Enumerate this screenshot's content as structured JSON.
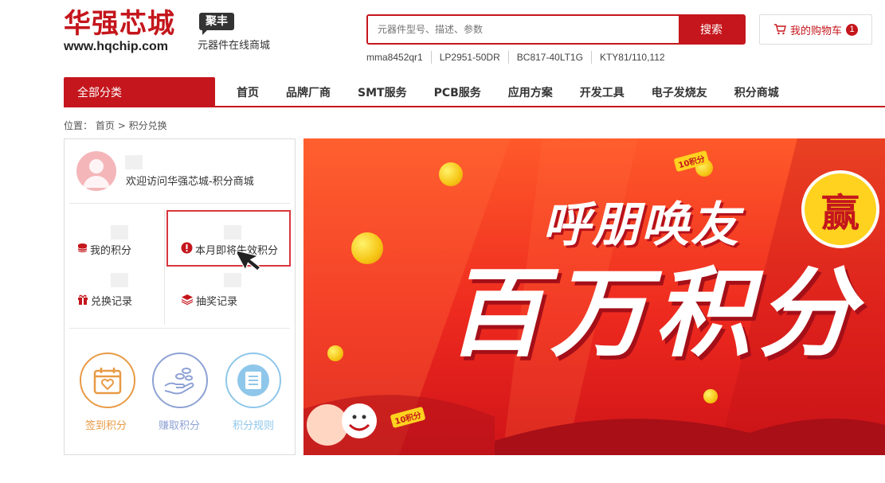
{
  "brand": {
    "name_cn": "华强芯城",
    "url": "www.hqchip.com",
    "badge": "聚丰",
    "slogan": "元器件在线商城"
  },
  "search": {
    "placeholder": "元器件型号、描述、参数",
    "button_label": "搜索"
  },
  "hot_words": [
    "mma8452qr1",
    "LP2951-50DR",
    "BC817-40LT1G",
    "KTY81/110,112"
  ],
  "cart": {
    "label": "我的购物车",
    "count": "1"
  },
  "nav": {
    "all_categories": "全部分类",
    "items": [
      "首页",
      "品牌厂商",
      "SMT服务",
      "PCB服务",
      "应用方案",
      "开发工具",
      "电子发烧友",
      "积分商城"
    ]
  },
  "breadcrumb": {
    "prefix": "位置：",
    "home": "首页",
    "separator": ">",
    "current": "积分兑换"
  },
  "panel": {
    "welcome": "欢迎访问华强芯城-积分商城",
    "stats": {
      "my_points": "我的积分",
      "expiring_points": "本月即将失效积分",
      "exchange_record": "兑换记录",
      "lottery_record": "抽奖记录"
    },
    "actions": {
      "checkin": "签到积分",
      "earn": "赚取积分",
      "rules": "积分规则"
    },
    "colors": {
      "checkin": "#e89a45",
      "earn": "#8fa2d4",
      "rules": "#8fc7ea"
    }
  },
  "banner": {
    "headline_top": "呼朋唤友",
    "headline_main": "百万积分",
    "badge": "赢",
    "tag": "10积分"
  },
  "colors": {
    "brand_red": "#c4161c",
    "banner_red": "#ee2a1f",
    "coin_gold": "#f6c515"
  }
}
